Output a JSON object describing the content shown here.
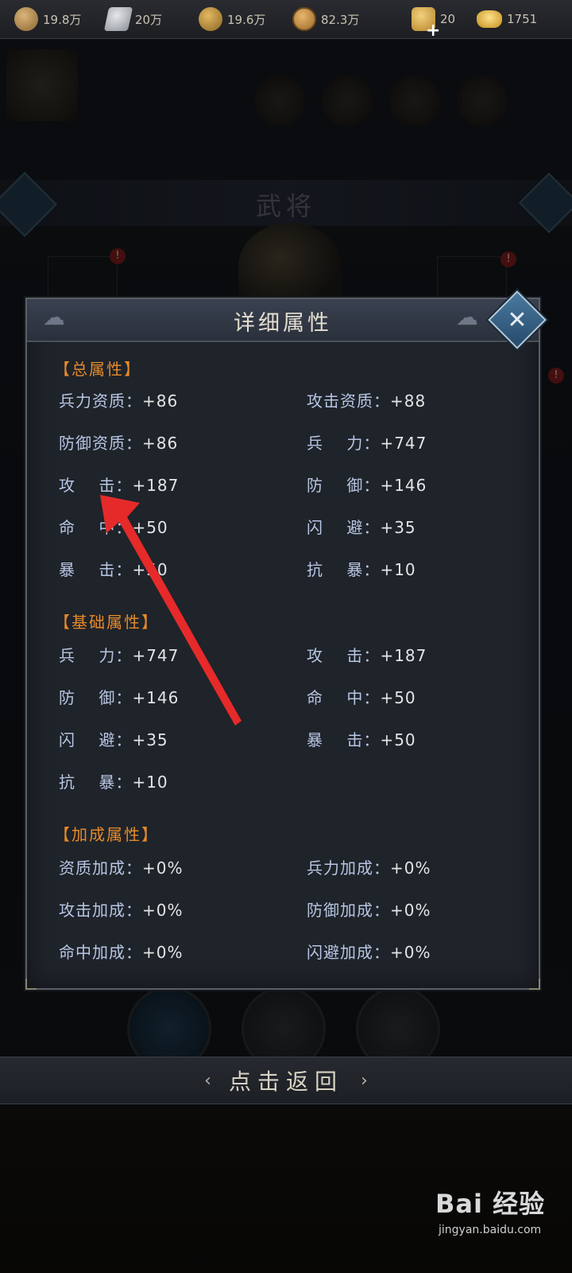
{
  "resources": [
    {
      "icon": "wood-icon",
      "value": "19.8万"
    },
    {
      "icon": "iron-icon",
      "value": "20万"
    },
    {
      "icon": "grain-icon",
      "value": "19.6万"
    },
    {
      "icon": "copper-coin-icon",
      "value": "82.3万"
    },
    {
      "icon": "token-icon",
      "value": "20"
    },
    {
      "icon": "gold-ingot-icon",
      "value": "1751"
    }
  ],
  "background": {
    "page_title": "武将"
  },
  "panel": {
    "title": "详细属性",
    "sections": [
      {
        "title": "【总属性】",
        "rows": [
          {
            "left_label": "兵力资质：",
            "left_value": "+86",
            "right_label": "攻击资质：",
            "right_value": "+88"
          },
          {
            "left_label": "防御资质：",
            "left_value": "+86",
            "right_label": "兵    力：",
            "right_value": "+747"
          },
          {
            "left_label": "攻    击：",
            "left_value": "+187",
            "right_label": "防    御：",
            "right_value": "+146"
          },
          {
            "left_label": "命    中：",
            "left_value": "+50",
            "right_label": "闪    避：",
            "right_value": "+35"
          },
          {
            "left_label": "暴    击：",
            "left_value": "+50",
            "right_label": "抗    暴：",
            "right_value": "+10"
          }
        ]
      },
      {
        "title": "【基础属性】",
        "rows": [
          {
            "left_label": "兵    力：",
            "left_value": "+747",
            "right_label": "攻    击：",
            "right_value": "+187"
          },
          {
            "left_label": "防    御：",
            "left_value": "+146",
            "right_label": "命    中：",
            "right_value": "+50"
          },
          {
            "left_label": "闪    避：",
            "left_value": "+35",
            "right_label": "暴    击：",
            "right_value": "+50"
          },
          {
            "left_label": "抗    暴：",
            "left_value": "+10",
            "right_label": "",
            "right_value": ""
          }
        ]
      },
      {
        "title": "【加成属性】",
        "rows": [
          {
            "left_label": "资质加成：",
            "left_value": "+0%",
            "right_label": "兵力加成：",
            "right_value": "+0%"
          },
          {
            "left_label": "攻击加成：",
            "left_value": "+0%",
            "right_label": "防御加成：",
            "right_value": "+0%"
          },
          {
            "left_label": "命中加成：",
            "left_value": "+0%",
            "right_label": "闪避加成：",
            "right_value": "+0%"
          }
        ]
      }
    ]
  },
  "return_button": {
    "label": "点击返回"
  },
  "watermark": {
    "brand": "Bai 经验",
    "url": "jingyan.baidu.com"
  },
  "colors": {
    "section_title": "#e58a2a",
    "label": "#b7c6e3",
    "value": "#e4e4e4",
    "annotation_arrow": "#e62a2a"
  }
}
